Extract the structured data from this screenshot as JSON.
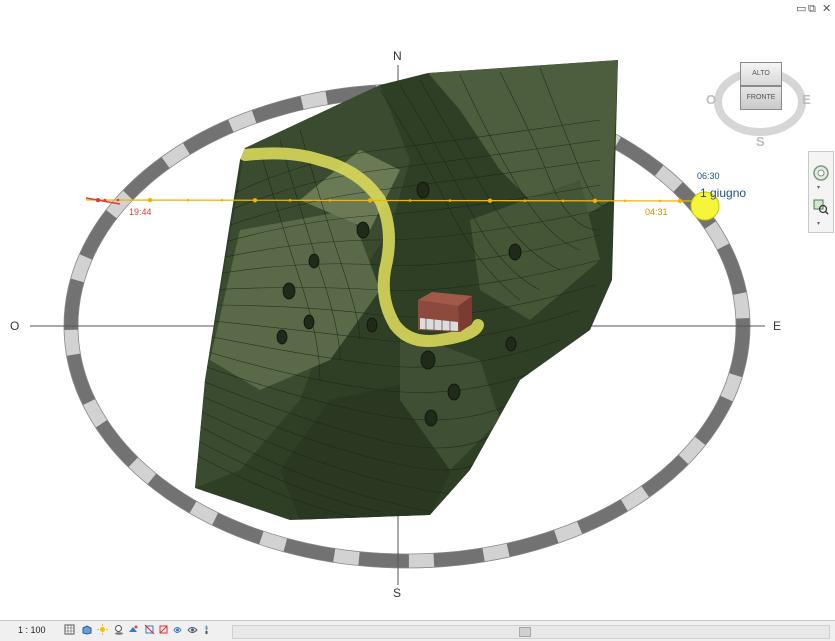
{
  "window": {
    "restore_glyph": "▭",
    "maximize_glyph": "⧉",
    "close_glyph": "✕"
  },
  "compass": {
    "north": "N",
    "south": "S",
    "east": "E",
    "west": "O"
  },
  "sun_path": {
    "sunset_time": "19:44",
    "sunrise_time": "04:31",
    "current_time": "06:30",
    "date": "1 giugno",
    "path_color": "#f2b400",
    "sun_color": "#f5f53a",
    "sunset_color": "#e23b3b"
  },
  "viewcube": {
    "top_label": "ALTO",
    "front_label": "FRONTE",
    "west": "O",
    "east": "E",
    "south": "S"
  },
  "navbar": {
    "icons": [
      "steering-wheel-icon",
      "zoom-region-icon"
    ]
  },
  "statusbar": {
    "scale": "1 : 100",
    "icons": [
      "detail-level-icon",
      "visual-style-icon",
      "sun-path-icon",
      "shadows-icon",
      "render-icon",
      "crop-view-icon",
      "hide-crop-icon",
      "temporary-isolate-icon",
      "reveal-hidden-icon",
      "analysis-icon"
    ]
  },
  "terrain": {
    "colors": {
      "dark": "#2f3f26",
      "mid": "#4b5c3c",
      "light": "#6b7a5b",
      "road": "#d8d85a"
    }
  },
  "building": {
    "roof_color": "#8b4a3c"
  }
}
